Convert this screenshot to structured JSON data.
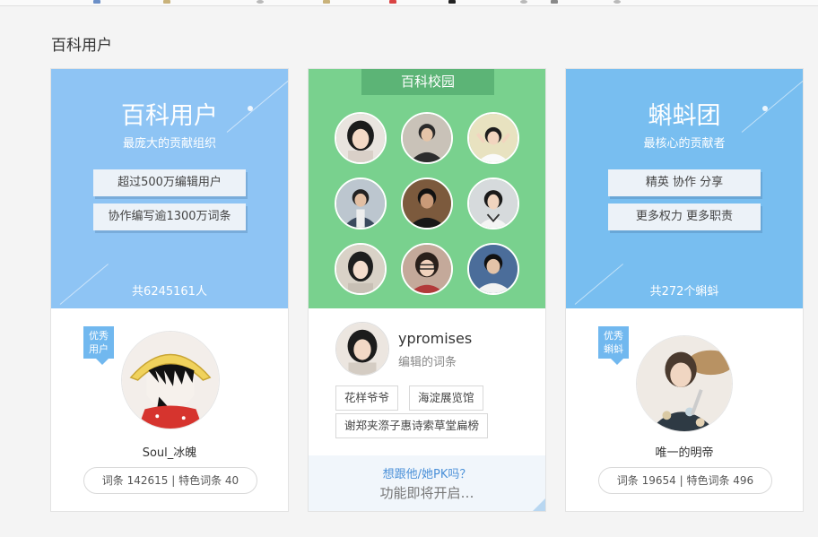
{
  "section_title": "百科用户",
  "cards": {
    "users": {
      "title": "百科用户",
      "subtitle": "最庞大的贡献组织",
      "pill1": "超过500万编辑用户",
      "pill2": "协作编写逾1300万词条",
      "count": "共6245161人",
      "badge_line1": "优秀",
      "badge_line2": "用户",
      "user_name": "Soul_冰魄",
      "stats": "词条 142615 | 特色词条 40"
    },
    "campus": {
      "tag": "百科校园",
      "user_name": "ypromises",
      "user_sub": "编辑的词条",
      "tags": [
        "花样爷爷",
        "海淀展览馆",
        "谢郑夹漈子惠诗索草堂扁榜"
      ],
      "pk_link": "想跟他/她PK吗？",
      "pk_soon": "功能即将开启…"
    },
    "tadpole": {
      "title": "蝌蚪团",
      "subtitle": "最核心的贡献者",
      "pill1": "精英 协作 分享",
      "pill2": "更多权力 更多职责",
      "count": "共272个蝌蚪",
      "badge_line1": "优秀",
      "badge_line2": "蝌蚪",
      "user_name": "唯一的明帝",
      "stats": "词条 19654 | 特色词条 496"
    }
  },
  "colors": {
    "users_bg": "#8ec4f4",
    "campus_bg": "#79d18e",
    "tadpole_bg": "#78bef0",
    "link": "#4a90d8"
  },
  "icons": {
    "badge": "ribbon-badge",
    "avatars": "user-avatar"
  }
}
